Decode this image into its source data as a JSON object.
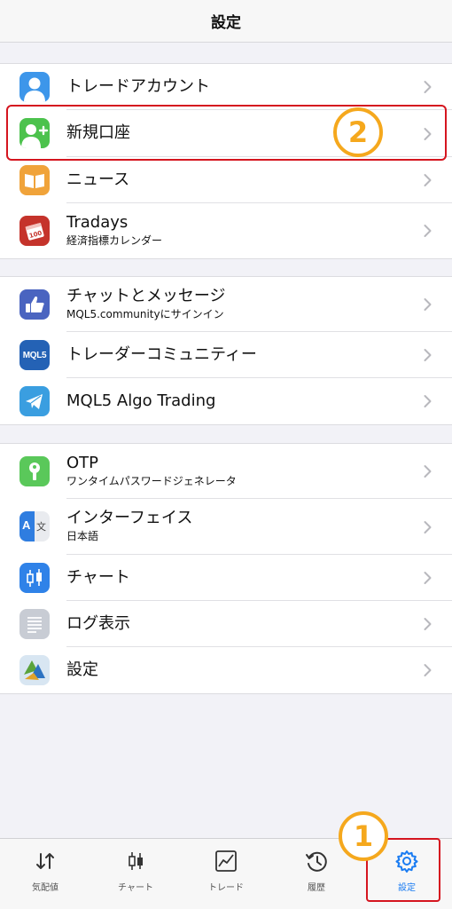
{
  "header": {
    "title": "設定"
  },
  "groups": [
    {
      "items": [
        {
          "label": "トレードアカウント",
          "sub": "",
          "icon": "person-icon"
        },
        {
          "label": "新規口座",
          "sub": "",
          "icon": "add-person-icon"
        },
        {
          "label": "ニュース",
          "sub": "",
          "icon": "book-icon"
        },
        {
          "label": "Tradays",
          "sub": "経済指標カレンダー",
          "icon": "calendar-icon"
        }
      ]
    },
    {
      "items": [
        {
          "label": "チャットとメッセージ",
          "sub": "MQL5.communityにサインイン",
          "icon": "thumbs-up-icon"
        },
        {
          "label": "トレーダーコミュニティー",
          "sub": "",
          "icon": "mql5-icon",
          "icon_text": "MQL5"
        },
        {
          "label": "MQL5 Algo Trading",
          "sub": "",
          "icon": "telegram-icon"
        }
      ]
    },
    {
      "items": [
        {
          "label": "OTP",
          "sub": "ワンタイムパスワードジェネレータ",
          "icon": "key-icon"
        },
        {
          "label": "インターフェイス",
          "sub": "日本語",
          "icon": "language-icon",
          "icon_text_a": "A",
          "icon_text_b": "文"
        },
        {
          "label": "チャート",
          "sub": "",
          "icon": "candlestick-icon"
        },
        {
          "label": "ログ表示",
          "sub": "",
          "icon": "document-icon"
        },
        {
          "label": "設定",
          "sub": "",
          "icon": "metatrader-icon"
        }
      ]
    }
  ],
  "annotations": {
    "badge_1": "1",
    "badge_2": "2"
  },
  "tabs": [
    {
      "label": "気配値",
      "icon": "quotes-arrows-icon",
      "active": false
    },
    {
      "label": "チャート",
      "icon": "chart-bars-icon",
      "active": false
    },
    {
      "label": "トレード",
      "icon": "trade-chart-icon",
      "active": false
    },
    {
      "label": "履歴",
      "icon": "history-icon",
      "active": false
    },
    {
      "label": "設定",
      "icon": "settings-gear-icon",
      "active": true
    }
  ],
  "colors": {
    "accent": "#1a7cf2",
    "highlight_border": "#d5151f",
    "badge": "#f5a81d",
    "background": "#f2f2f7"
  }
}
